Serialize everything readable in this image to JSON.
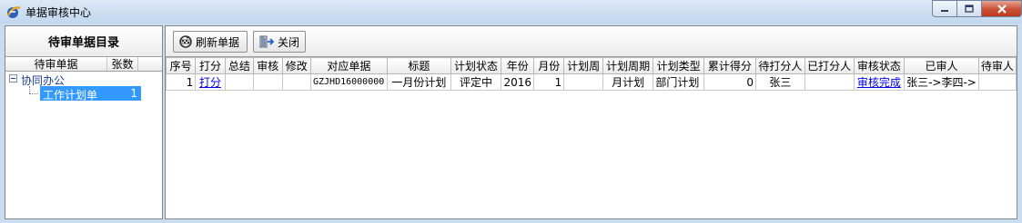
{
  "window": {
    "title": "单据审核中心",
    "colors": {
      "titlebar": "#c9dcf0",
      "selection": "#3399ff",
      "link": "#0000ee"
    }
  },
  "left": {
    "title": "待审单据目录",
    "headers": {
      "name": "待审单据",
      "count": "张数"
    },
    "tree": {
      "parent": "协同办公",
      "child": {
        "label": "工作计划单",
        "count": "1"
      }
    }
  },
  "toolbar": {
    "refresh_label": "刷新单据",
    "close_label": "关闭"
  },
  "grid": {
    "columns": [
      "序号",
      "打分",
      "总结",
      "审核",
      "修改",
      "对应单据",
      "标题",
      "计划状态",
      "年份",
      "月份",
      "计划周",
      "计划周期",
      "计划类型",
      "累计得分",
      "待打分人",
      "已打分人",
      "审核状态",
      "已审人",
      "待审人"
    ],
    "rows": [
      {
        "seq": "1",
        "score_link": "打分",
        "summary": "",
        "review": "",
        "edit": "",
        "doc": "GZJHD16000000",
        "title": "一月份计划",
        "plan_status": "评定中",
        "year": "2016",
        "month": "1",
        "week": "",
        "period": "月计划",
        "type": "部门计划",
        "total_score": "0",
        "pending_scorer": "张三",
        "done_scorer": "",
        "audit_status": "审核完成",
        "audited_by": "张三->李四->",
        "pending_auditor": ""
      }
    ]
  }
}
